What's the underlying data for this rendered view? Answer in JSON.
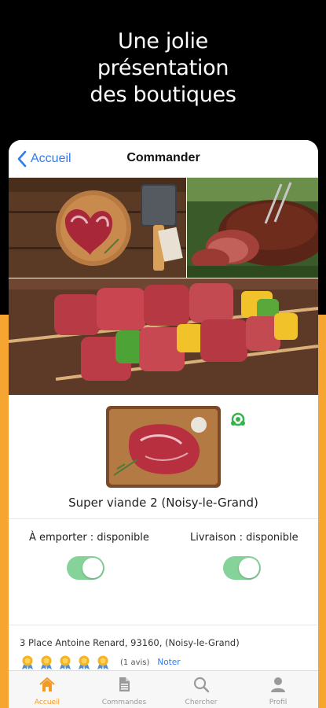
{
  "promo": {
    "line1": "Une jolie",
    "line2": "présentation",
    "line3": "des boutiques"
  },
  "navbar": {
    "back_label": "Accueil",
    "title": "Commander"
  },
  "shop": {
    "name": "Super viande 2 (Noisy-le-Grand)",
    "address": "3 Place Antoine Renard, 93160, (Noisy-le-Grand)"
  },
  "options": {
    "takeaway": {
      "label": "À emporter : disponible",
      "enabled": true
    },
    "delivery": {
      "label": "Livraison : disponible",
      "enabled": true
    }
  },
  "rating": {
    "medals": 5,
    "reviews": "(1 avis)",
    "rate_link": "Noter"
  },
  "tabbar": {
    "items": [
      {
        "label": "Accueil",
        "icon": "home-icon",
        "active": true
      },
      {
        "label": "Commandes",
        "icon": "document-icon",
        "active": false
      },
      {
        "label": "Chercher",
        "icon": "search-icon",
        "active": false
      },
      {
        "label": "Profil",
        "icon": "person-icon",
        "active": false
      }
    ]
  },
  "colors": {
    "accent_orange": "#F6A531",
    "link_blue": "#2B7BF5",
    "toggle_green": "#86D39A",
    "active_tab": "#F29A28",
    "background_black": "#000000"
  }
}
